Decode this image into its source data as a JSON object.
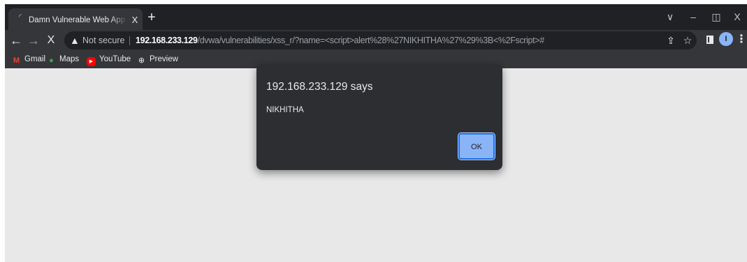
{
  "tab": {
    "title": "Damn Vulnerable Web App (DVWA)",
    "close_glyph": "X"
  },
  "window_controls": {
    "dropdown": "∨",
    "minimize": "–",
    "restore": "◫",
    "close": "X"
  },
  "nav": {
    "back": "←",
    "forward": "→",
    "stop": "X"
  },
  "omnibox": {
    "security_label": "Not secure",
    "url_host": "192.168.233.129",
    "url_path": "/dvwa/vulnerabilities/xss_r/?name=<script>alert%28%27NIKHITHA%27%29%3B<%2Fscript>#"
  },
  "profile": {
    "initial": "I"
  },
  "bookmarks": [
    {
      "label": "Gmail",
      "icon": "gmail-icon"
    },
    {
      "label": "Maps",
      "icon": "maps-icon"
    },
    {
      "label": "YouTube",
      "icon": "youtube-icon"
    },
    {
      "label": "Preview",
      "icon": "preview-icon"
    }
  ],
  "dialog": {
    "title": "192.168.233.129 says",
    "message": "NIKHITHA",
    "ok_label": "OK"
  },
  "colors": {
    "tab_strip": "#202124",
    "toolbar": "#35363a",
    "page_background": "#e8e8e8",
    "dialog_background": "#2d2e31",
    "ok_button": "#8ab4f8"
  }
}
